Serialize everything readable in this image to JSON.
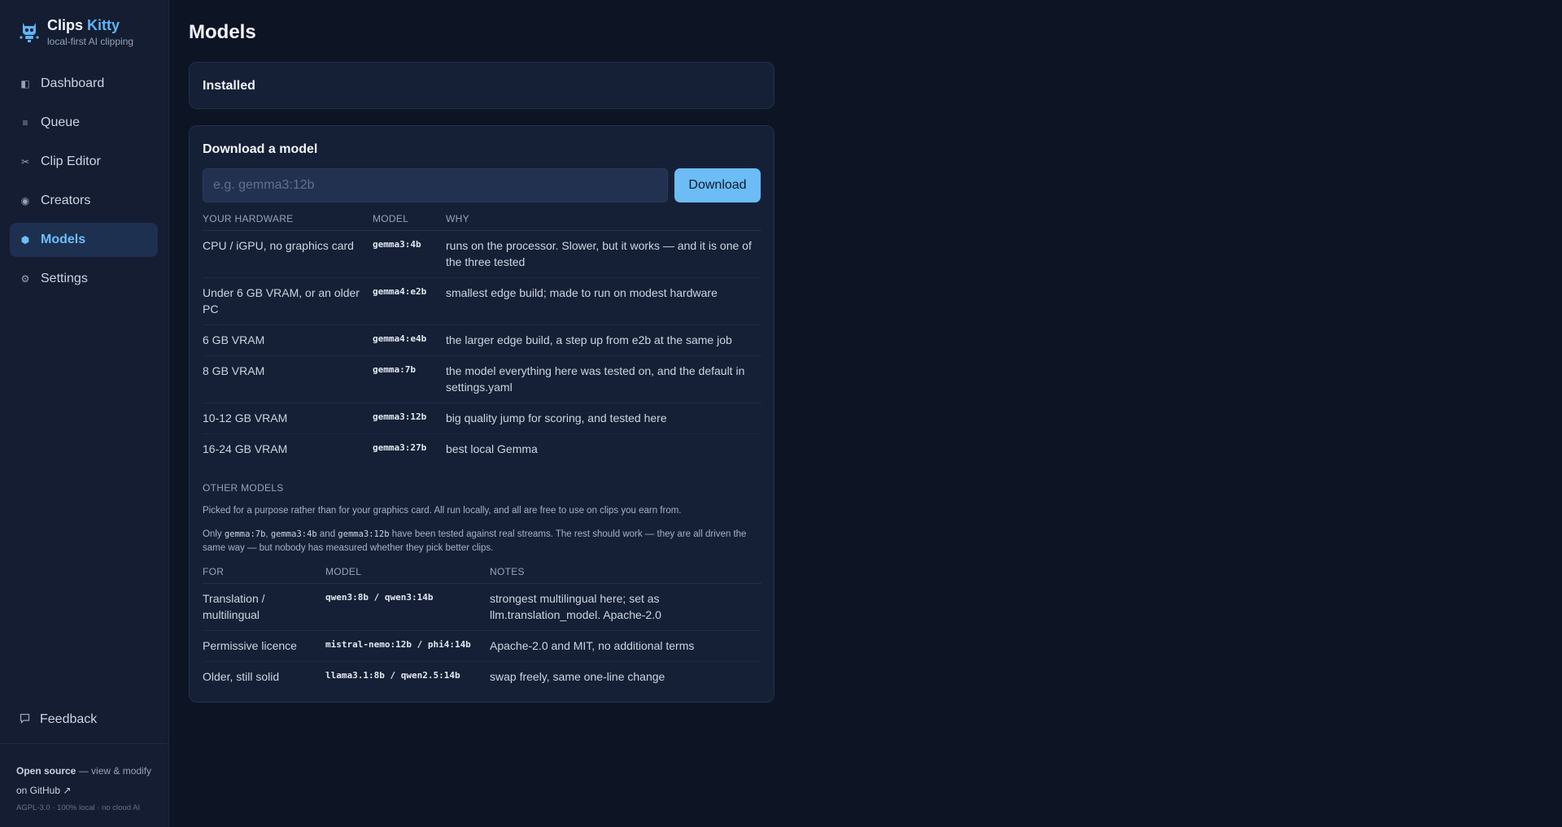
{
  "brand": {
    "name_part1": "Clips",
    "name_part2": "Kitty",
    "tagline": "local-first AI clipping"
  },
  "nav": {
    "items": [
      {
        "label": "Dashboard",
        "icon": "panel-icon"
      },
      {
        "label": "Queue",
        "icon": "list-icon"
      },
      {
        "label": "Clip Editor",
        "icon": "scissors-icon"
      },
      {
        "label": "Creators",
        "icon": "radio-icon"
      },
      {
        "label": "Models",
        "icon": "hexagon-icon",
        "active": true
      },
      {
        "label": "Settings",
        "icon": "gear-icon"
      }
    ]
  },
  "footer": {
    "feedback_label": "Feedback",
    "open_source_bold": "Open source",
    "open_source_rest": " — view & modify",
    "github_link": "on GitHub ↗",
    "license": "AGPL-3.0 · 100% local · no cloud AI"
  },
  "page": {
    "title": "Models"
  },
  "installed": {
    "title": "Installed"
  },
  "download": {
    "title": "Download a model",
    "placeholder": "e.g. gemma3:12b",
    "button_label": "Download"
  },
  "hardware_table": {
    "headers": [
      "YOUR HARDWARE",
      "MODEL",
      "WHY"
    ],
    "rows": [
      [
        "CPU / iGPU, no graphics card",
        "gemma3:4b",
        "runs on the processor. Slower, but it works — and it is one of the three tested"
      ],
      [
        "Under 6 GB VRAM, or an older PC",
        "gemma4:e2b",
        "smallest edge build; made to run on modest hardware"
      ],
      [
        "6 GB VRAM",
        "gemma4:e4b",
        "the larger edge build, a step up from e2b at the same job"
      ],
      [
        "8 GB VRAM",
        "gemma:7b",
        "the model everything here was tested on, and the default in settings.yaml"
      ],
      [
        "10-12 GB VRAM",
        "gemma3:12b",
        "big quality jump for scoring, and tested here"
      ],
      [
        "16-24 GB VRAM",
        "gemma3:27b",
        "best local Gemma"
      ]
    ]
  },
  "other_models": {
    "label": "OTHER MODELS",
    "note1": "Picked for a purpose rather than for your graphics card. All run locally, and all are free to use on clips you earn from.",
    "note2_prefix": "Only ",
    "note2_code1": "gemma:7b",
    "note2_sep1": ", ",
    "note2_code2": "gemma3:4b",
    "note2_sep2": " and ",
    "note2_code3": "gemma3:12b",
    "note2_suffix": " have been tested against real streams. The rest should work — they are all driven the same way — but nobody has measured whether they pick better clips.",
    "headers": [
      "FOR",
      "MODEL",
      "NOTES"
    ],
    "rows": [
      [
        "Translation / multilingual",
        "qwen3:8b / qwen3:14b",
        "strongest multilingual here; set as llm.translation_model. Apache-2.0"
      ],
      [
        "Permissive licence",
        "mistral-nemo:12b / phi4:14b",
        "Apache-2.0 and MIT, no additional terms"
      ],
      [
        "Older, still solid",
        "llama3.1:8b / qwen2.5:14b",
        "swap freely, same one-line change"
      ]
    ]
  },
  "colors": {
    "accent": "#6cbcf5",
    "background": "#0d1424",
    "sidebar": "#141d31",
    "card": "#152036"
  }
}
